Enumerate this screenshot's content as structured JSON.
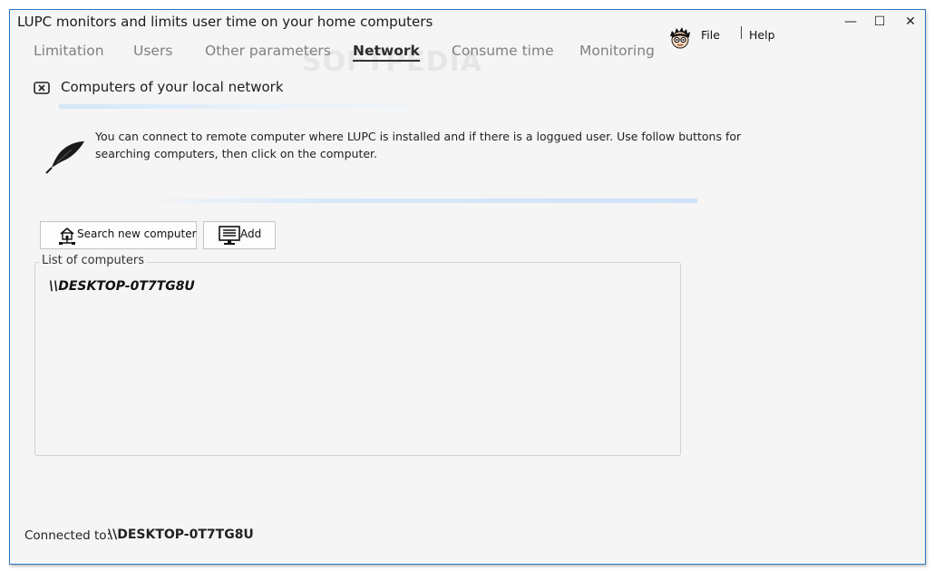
{
  "window": {
    "title": "LUPC monitors and limits user time on your home computers",
    "controls": {
      "minimize": "—",
      "maximize": "☐",
      "close": "✕"
    }
  },
  "tabs": [
    {
      "label": "Limitation"
    },
    {
      "label": "Users"
    },
    {
      "label": "Other parameters"
    },
    {
      "label": "Network",
      "active": true
    },
    {
      "label": "Consume time"
    },
    {
      "label": "Monitoring"
    }
  ],
  "watermark": "SOFTPEDIA",
  "menu": {
    "file": "File",
    "help": "Help"
  },
  "section": {
    "title": "Computers of your local network"
  },
  "info": {
    "text": "You can connect to remote computer where LUPC is installed and if there is a loggued user. Use follow buttons for searching computers, then click on the computer."
  },
  "buttons": {
    "search": "Search new computer",
    "add": "Add"
  },
  "computers": {
    "label": "List of computers",
    "items": [
      "\\\\DESKTOP-0T7TG8U"
    ]
  },
  "status": {
    "label": "Connected to:",
    "value": "\\\\DESKTOP-0T7TG8U"
  },
  "icons": {
    "section": "close-box-icon",
    "info": "quill-icon",
    "search": "network-home-icon",
    "add": "computer-monitor-icon",
    "avatar": "cartoon-avatar-icon"
  },
  "colors": {
    "window_border": "#2a78c6",
    "background": "#f5f5f5",
    "accent_gradient": "#d2e6f8",
    "tab_inactive": "#808080"
  }
}
